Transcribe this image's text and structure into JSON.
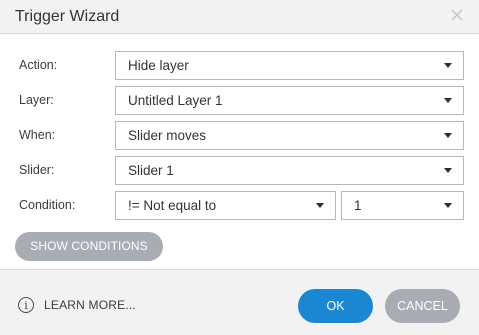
{
  "dialog": {
    "title": "Trigger Wizard",
    "close_icon": "close-icon"
  },
  "fields": {
    "action": {
      "label": "Action:",
      "value": "Hide layer"
    },
    "layer": {
      "label": "Layer:",
      "value": "Untitled Layer 1"
    },
    "when": {
      "label": "When:",
      "value": "Slider moves"
    },
    "slider": {
      "label": "Slider:",
      "value": "Slider 1"
    },
    "condition": {
      "label": "Condition:",
      "operator": "!= Not equal to",
      "value": "1"
    }
  },
  "show_conditions_label": "SHOW CONDITIONS",
  "footer": {
    "learn_more_label": "LEARN MORE...",
    "ok_label": "OK",
    "cancel_label": "CANCEL"
  },
  "colors": {
    "primary": "#1b87d3",
    "secondary": "#a9adb3",
    "header_bg": "#f2f2f2"
  }
}
